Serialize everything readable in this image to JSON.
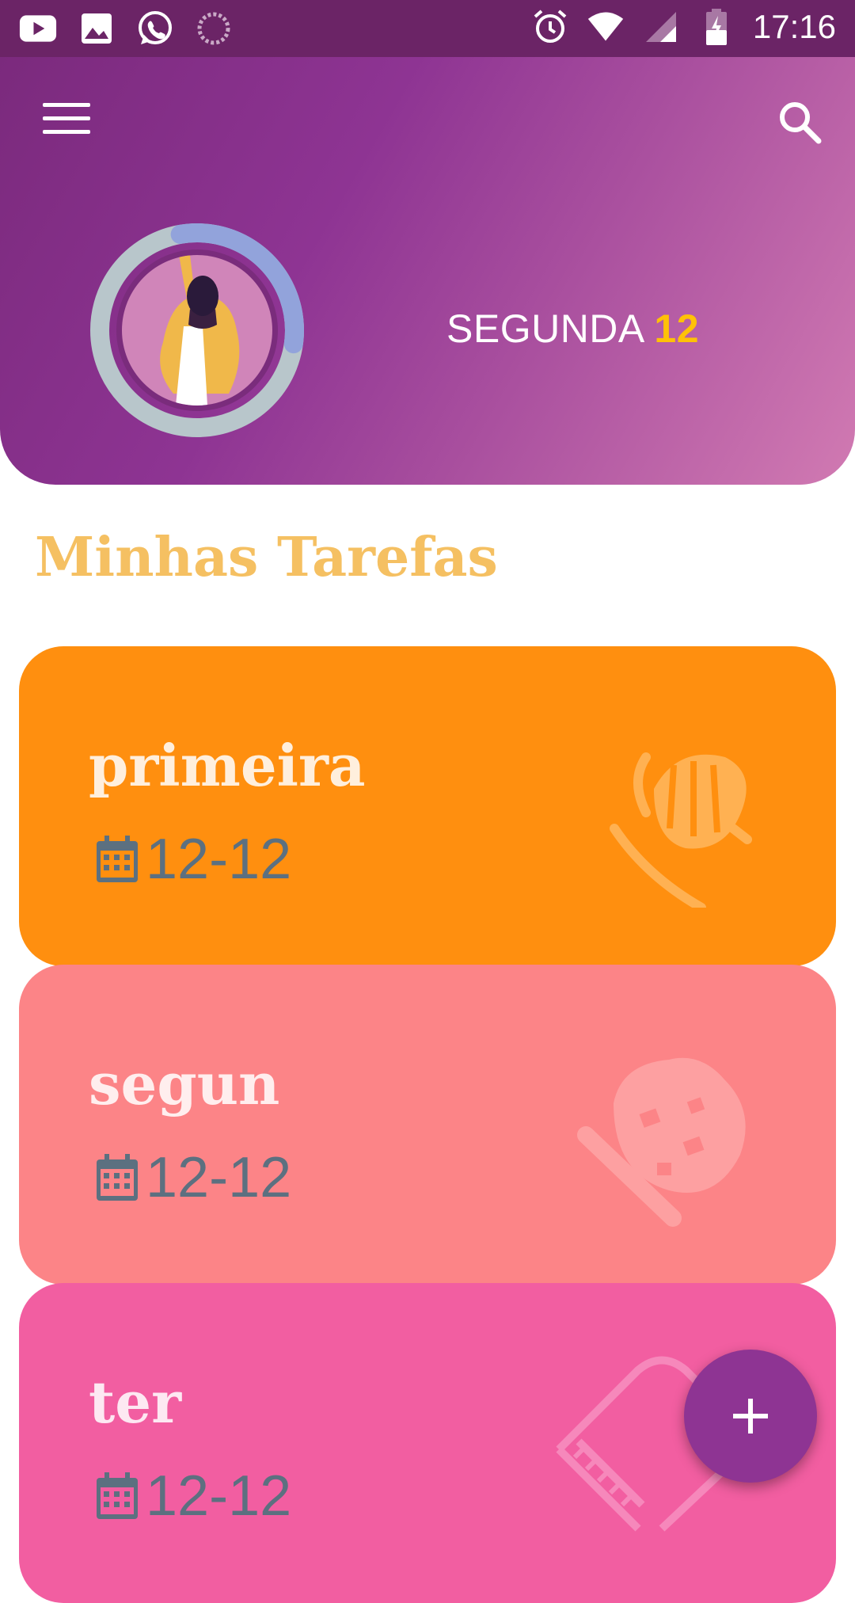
{
  "status_bar": {
    "time": "17:16",
    "left_icons": [
      "youtube-icon",
      "image-icon",
      "whatsapp-icon",
      "loading-icon"
    ],
    "right_icons": [
      "alarm-icon",
      "wifi-icon",
      "signal-icon",
      "battery-icon"
    ]
  },
  "header": {
    "day_name": "SEGUNDA",
    "day_number": "12",
    "avatar_progress": 0.3
  },
  "section": {
    "title": "Minhas Tarefas"
  },
  "tasks": [
    {
      "title": "primeira",
      "date": "12-12",
      "color": "#ff8f0f",
      "icon": "microphone-icon"
    },
    {
      "title": "segun",
      "date": "12-12",
      "color": "#fc8487",
      "icon": "ice-cream-icon"
    },
    {
      "title": "ter",
      "date": "12-12",
      "color": "#f25ea1",
      "icon": "piano-icon"
    }
  ],
  "fab": {
    "label": "+"
  },
  "colors": {
    "accent": "#8e3493",
    "title_gold": "#f5c062",
    "day_number": "#ffc107"
  }
}
